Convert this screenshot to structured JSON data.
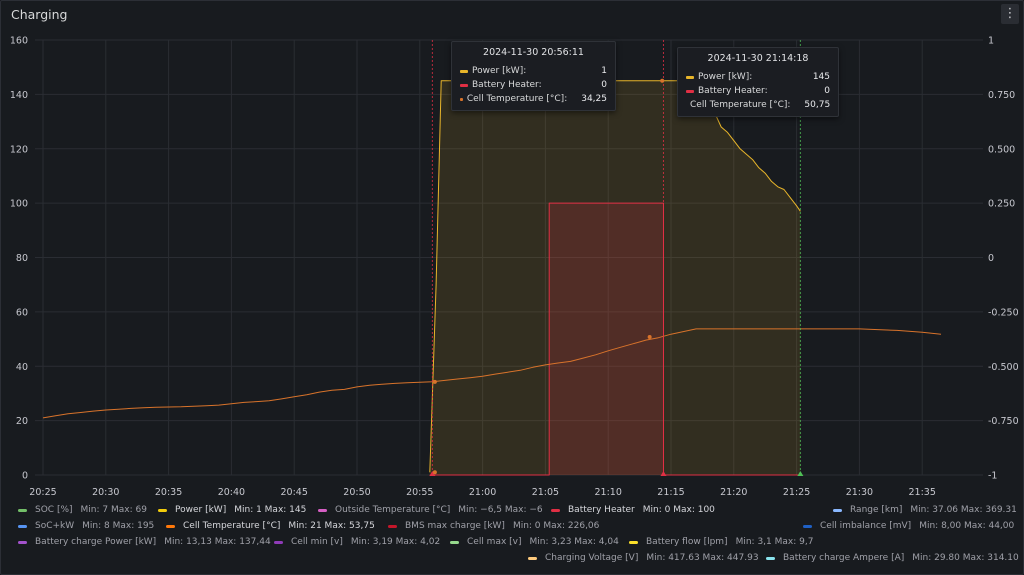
{
  "panel": {
    "title": "Charging",
    "menu_icon": "kebab-menu-icon"
  },
  "chart_data": {
    "type": "line",
    "xlabel": "",
    "ylabel": "",
    "x_ticks": [
      "20:25",
      "20:30",
      "20:35",
      "20:40",
      "20:45",
      "20:50",
      "20:55",
      "21:00",
      "21:05",
      "21:10",
      "21:15",
      "21:20",
      "21:25",
      "21:30",
      "21:35"
    ],
    "x_tick_minutes": [
      0,
      5,
      10,
      15,
      20,
      25,
      30,
      35,
      40,
      45,
      50,
      55,
      60,
      65,
      70
    ],
    "y_left_ticks": [
      "0",
      "20",
      "40",
      "60",
      "80",
      "100",
      "120",
      "140",
      "160"
    ],
    "y_left_range": [
      0,
      160
    ],
    "y_right_ticks": [
      "-1",
      "-0.750",
      "-0.500",
      "-0.250",
      "0",
      "0.250",
      "0.500",
      "0.750",
      "1"
    ],
    "y_right_range": [
      -1,
      1
    ],
    "grid": true,
    "series": [
      {
        "name": "Power [kW]",
        "color": "#e8b52a",
        "fill": true,
        "x_min": [
          30.8,
          31.3,
          31.7,
          32.6,
          35,
          40,
          45,
          50,
          52,
          53,
          53.5,
          54,
          54.5,
          55,
          55.5,
          56,
          56.5,
          57,
          57.5,
          58,
          58.5,
          59,
          59.5,
          60,
          60.3
        ],
        "y": [
          1,
          70,
          145,
          145,
          145,
          145,
          145,
          145,
          145,
          140,
          133,
          128,
          126,
          123,
          120,
          118,
          116,
          113,
          111,
          108,
          106,
          105,
          102,
          99,
          97
        ]
      },
      {
        "name": "Battery Heater",
        "color": "#e02f44",
        "fill": true,
        "x_min": [
          30.8,
          40.3,
          40.3,
          49.4,
          49.4,
          60.3
        ],
        "y": [
          0,
          0,
          100,
          100,
          0,
          0
        ]
      },
      {
        "name": "Cell Temperature [°C]",
        "color": "#d8732b",
        "fill": false,
        "x_min": [
          0,
          1,
          2,
          3,
          4,
          5,
          6,
          7,
          8,
          9,
          10,
          11,
          12,
          13,
          14,
          15,
          16,
          17,
          18,
          19,
          20,
          21,
          22,
          23,
          24,
          25,
          26,
          27,
          28,
          29,
          30,
          31,
          32,
          33,
          34,
          35,
          36,
          37,
          38,
          39,
          40,
          41,
          42,
          43,
          44,
          45,
          46,
          47,
          48,
          49,
          50,
          52,
          55,
          60,
          65,
          68,
          70,
          71.5
        ],
        "y": [
          21,
          21.8,
          22.5,
          23,
          23.5,
          23.9,
          24.2,
          24.5,
          24.7,
          24.9,
          25,
          25.1,
          25.3,
          25.5,
          25.7,
          26.2,
          26.7,
          27,
          27.3,
          28,
          28.8,
          29.5,
          30.5,
          31.2,
          31.5,
          32.4,
          33,
          33.4,
          33.7,
          33.9,
          34.1,
          34.3,
          34.8,
          35.3,
          35.8,
          36.3,
          37.1,
          37.8,
          38.5,
          39.6,
          40.5,
          41.2,
          41.8,
          43,
          44.2,
          45.7,
          47,
          48.3,
          49.6,
          50.5,
          51.8,
          53.75,
          53.75,
          53.75,
          53.75,
          53.2,
          52.5,
          51.8
        ]
      }
    ],
    "markers": [
      {
        "x_min": 31.0,
        "color": "#e02f44",
        "label": "annotation-start"
      },
      {
        "x_min": 49.4,
        "color": "#e02f44",
        "label": "annotation-heater-off"
      },
      {
        "x_min": 60.3,
        "color": "#4fbf56",
        "label": "annotation-end"
      }
    ],
    "tooltips": [
      {
        "time": "2024-11-30 20:56:11",
        "rows": [
          {
            "label": "Power [kW]:",
            "value": "1",
            "color": "#e8b52a"
          },
          {
            "label": "Battery Heater:",
            "value": "0",
            "color": "#e02f44"
          },
          {
            "label": "Cell Temperature [°C]:",
            "value": "34,25",
            "color": "#d8732b"
          }
        ]
      },
      {
        "time": "2024-11-30 21:14:18",
        "rows": [
          {
            "label": "Power [kW]:",
            "value": "145",
            "color": "#e8b52a"
          },
          {
            "label": "Battery Heater:",
            "value": "0",
            "color": "#e02f44"
          },
          {
            "label": "Cell Temperature [°C]:",
            "value": "50,75",
            "color": "#d8732b"
          }
        ]
      }
    ]
  },
  "legend": {
    "rows": [
      [
        {
          "name": "SOC [%]",
          "stats": "Min: 7  Max: 69",
          "color": "#73bf69",
          "on": false
        },
        {
          "name": "Power [kW]",
          "stats": "Min: 1  Max: 145",
          "color": "#f2cc0c",
          "on": true
        },
        {
          "name": "Outside Temperature [°C]",
          "stats": "Min: −6,5  Max: −6",
          "color": "#d65fc4",
          "on": false
        },
        {
          "name": "Battery Heater",
          "stats": "Min: 0  Max: 100",
          "color": "#e02f44",
          "on": true
        },
        {
          "name": "Range [km]",
          "stats": "Min: 37.06  Max: 369.31",
          "color": "#8ab8ff",
          "on": false
        }
      ],
      [
        {
          "name": "SoC+kW",
          "stats": "Min: 8  Max: 195",
          "color": "#5794f2",
          "on": false
        },
        {
          "name": "Cell Temperature [°C]",
          "stats": "Min: 21  Max: 53,75",
          "color": "#ff780a",
          "on": true
        },
        {
          "name": "BMS max charge [kW]",
          "stats": "Min: 0  Max: 226,06",
          "color": "#c4162a",
          "on": false
        },
        {
          "name": "Cell imbalance [mV]",
          "stats": "Min: 8,00  Max: 44,00",
          "color": "#1f60c4",
          "on": false
        }
      ],
      [
        {
          "name": "Battery charge Power [kW]",
          "stats": "Min: 13,13  Max: 137,44",
          "color": "#a352cc",
          "on": false
        },
        {
          "name": "Cell min [v]",
          "stats": "Min: 3,19  Max: 4,02",
          "color": "#8f3bb8",
          "on": false
        },
        {
          "name": "Cell max [v]",
          "stats": "Min: 3,23  Max: 4,04",
          "color": "#96d98d",
          "on": false
        },
        {
          "name": "Battery flow [lpm]",
          "stats": "Min: 3,1  Max: 9,7",
          "color": "#fade2a",
          "on": false
        }
      ],
      [
        {
          "name": "Charging Voltage [V]",
          "stats": "Min: 417.63  Max: 447.93",
          "color": "#ffcb7d",
          "on": false
        },
        {
          "name": "Battery charge Ampere [A]",
          "stats": "Min: 29.80  Max: 314.10",
          "color": "#8ae4ee",
          "on": false
        }
      ]
    ]
  }
}
